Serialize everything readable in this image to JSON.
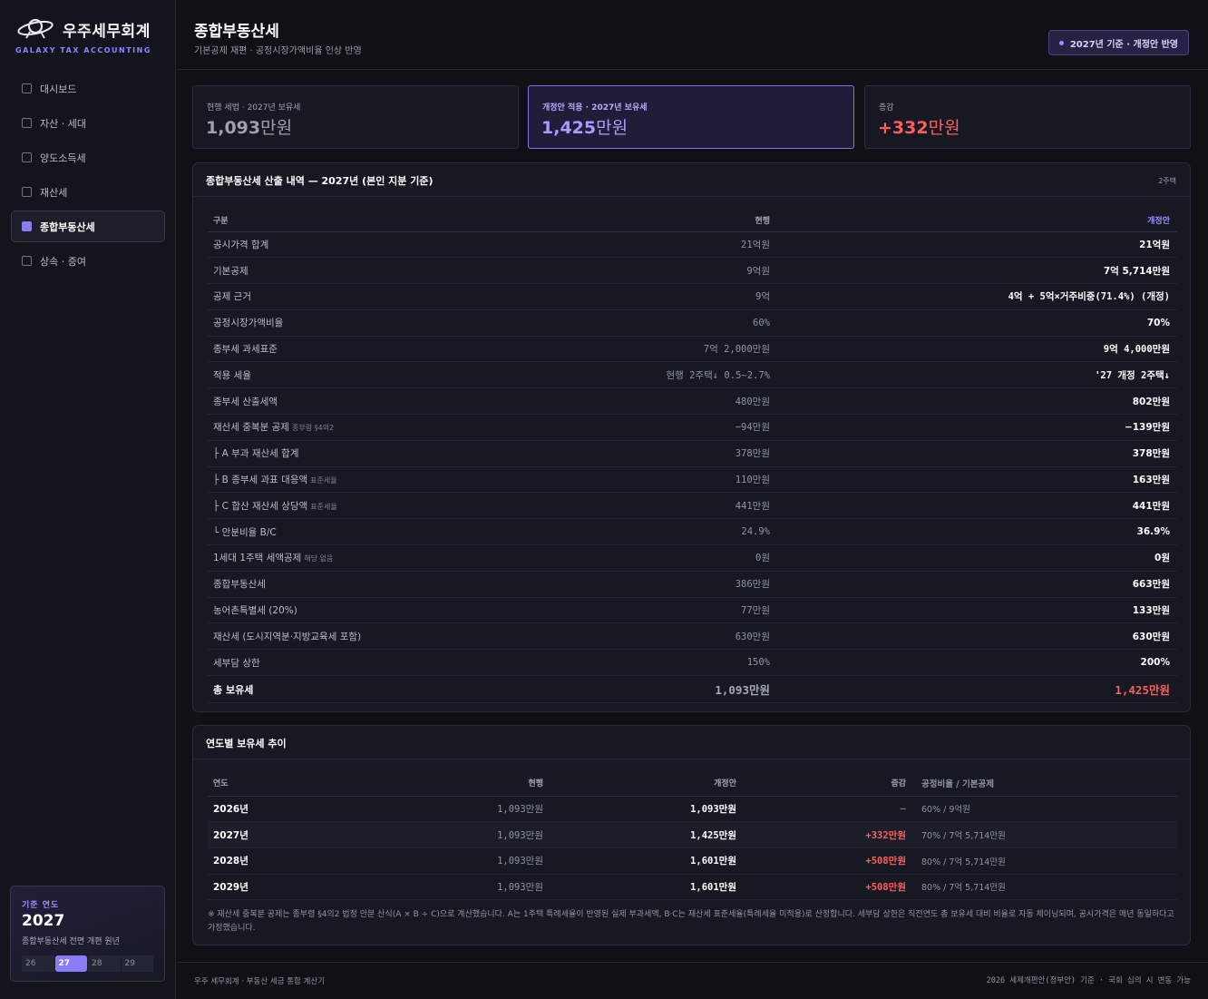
{
  "brand": {
    "name": "우주세무회계",
    "sub": "GALAXY TAX ACCOUNTING"
  },
  "nav": [
    {
      "label": "대시보드",
      "active": false
    },
    {
      "label": "자산 · 세대",
      "active": false
    },
    {
      "label": "양도소득세",
      "active": false
    },
    {
      "label": "재산세",
      "active": false
    },
    {
      "label": "종합부동산세",
      "active": true
    },
    {
      "label": "상속 · 증여",
      "active": false
    }
  ],
  "year_card": {
    "label": "기준 연도",
    "year": "2027",
    "note": "종합부동산세 전면 개편 원년",
    "tabs": [
      "26",
      "27",
      "28",
      "29"
    ],
    "active_tab": "27"
  },
  "header": {
    "title": "종합부동산세",
    "subtitle": "기본공제 재편 · 공정시장가액비율 인상 반영",
    "badge": "2027년 기준 · 개정안 반영"
  },
  "summary": [
    {
      "label": "현행 세법 · 2027년 보유세",
      "value": "1,093",
      "unit": "만원"
    },
    {
      "label": "개정안 적용 · 2027년 보유세",
      "value": "1,425",
      "unit": "만원"
    },
    {
      "label": "증감",
      "value": "+332",
      "unit": "만원"
    }
  ],
  "breakdown": {
    "title": "종합부동산세 산출 내역 — 2027년 (본인 지분 기준)",
    "tag": "2주택",
    "headers": {
      "item": "구분",
      "current": "현행",
      "revised": "개정안"
    },
    "rows": [
      {
        "item": "공시가격 합계",
        "note": "",
        "current": "21억원",
        "revised": "21억원"
      },
      {
        "item": "기본공제",
        "note": "",
        "current": "9억원",
        "revised": "7억 5,714만원"
      },
      {
        "item": "공제 근거",
        "note": "",
        "current": "9억",
        "revised": "4억 + 5억×거주비중(71.4%) (개정)"
      },
      {
        "item": "공정시장가액비율",
        "note": "",
        "current": "60%",
        "revised": "70%"
      },
      {
        "item": "종부세 과세표준",
        "note": "",
        "current": "7억 2,000만원",
        "revised": "9억 4,000만원"
      },
      {
        "item": "적용 세율",
        "note": "",
        "current": "현행 2주택↓ 0.5~2.7%",
        "revised": "'27 개정 2주택↓"
      },
      {
        "item": "종부세 산출세액",
        "note": "",
        "current": "480만원",
        "revised": "802만원"
      },
      {
        "item": "재산세 중복분 공제",
        "note": "종부령 §4의2",
        "current": "−94만원",
        "revised": "−139만원"
      },
      {
        "item": "├ A 부과 재산세 합계",
        "note": "",
        "current": "378만원",
        "revised": "378만원"
      },
      {
        "item": "├ B 종부세 과표 대응액",
        "note": "표준세율",
        "current": "110만원",
        "revised": "163만원"
      },
      {
        "item": "├ C 합산 재산세 상당액",
        "note": "표준세율",
        "current": "441만원",
        "revised": "441만원"
      },
      {
        "item": "└ 안분비율 B/C",
        "note": "",
        "current": "24.9%",
        "revised": "36.9%"
      },
      {
        "item": "1세대 1주택 세액공제",
        "note": "해당 없음",
        "current": "0원",
        "revised": "0원"
      },
      {
        "item": "종합부동산세",
        "note": "",
        "current": "386만원",
        "revised": "663만원"
      },
      {
        "item": "농어촌특별세 (20%)",
        "note": "",
        "current": "77만원",
        "revised": "133만원"
      },
      {
        "item": "재산세 (도시지역분·지방교육세 포함)",
        "note": "",
        "current": "630만원",
        "revised": "630만원"
      },
      {
        "item": "세부담 상한",
        "note": "",
        "current": "150%",
        "revised": "200%"
      }
    ],
    "total": {
      "item": "총 보유세",
      "current": "1,093만원",
      "revised": "1,425만원"
    }
  },
  "trend": {
    "title": "연도별 보유세 추이",
    "headers": {
      "year": "연도",
      "current": "현행",
      "revised": "개정안",
      "diff": "증감",
      "ratio": "공정비율 / 기본공제"
    },
    "rows": [
      {
        "year": "2026년",
        "current": "1,093만원",
        "revised": "1,093만원",
        "diff": "—",
        "ratio": "60% / 9억원"
      },
      {
        "year": "2027년",
        "current": "1,093만원",
        "revised": "1,425만원",
        "diff": "+332만원",
        "ratio": "70% / 7억 5,714만원"
      },
      {
        "year": "2028년",
        "current": "1,093만원",
        "revised": "1,601만원",
        "diff": "+508만원",
        "ratio": "80% / 7억 5,714만원"
      },
      {
        "year": "2029년",
        "current": "1,093만원",
        "revised": "1,601만원",
        "diff": "+508만원",
        "ratio": "80% / 7억 5,714만원"
      }
    ],
    "note": "※ 재산세 중복분 공제는 종부령 §4의2 법정 안분 산식(A × B ÷ C)으로 계산했습니다. A는 1주택 특례세율이 반영된 실제 부과세액, B·C는 재산세 표준세율(특례세율 미적용)로 산정합니다. 세부담 상한은 직전연도 총 보유세 대비 비율로 자동 체이닝되며, 공시가격은 매년 동일하다고 가정했습니다."
  },
  "footer": {
    "left": "우주 세무회계 · 부동산 세금 통합 계산기",
    "right": "2026 세제개편안(정부안) 기준 · 국회 심의 시 변동 가능"
  }
}
